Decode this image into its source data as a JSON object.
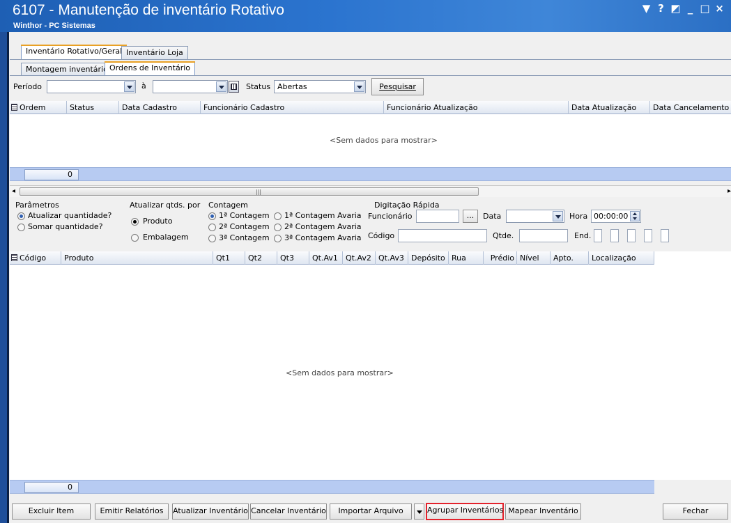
{
  "window": {
    "title": "6107 - Manutenção de inventário Rotativo",
    "subtitle": "Winthor - PC Sistemas",
    "controls": [
      "▼",
      "?",
      "◩",
      "_",
      "□",
      "×"
    ]
  },
  "tabs_top": [
    {
      "label": "Inventário Rotativo/Geral",
      "active": true
    },
    {
      "label": "Inventário Loja",
      "active": false
    }
  ],
  "tabs_sub": [
    {
      "label": "Montagem inventário",
      "active": false
    },
    {
      "label": "Ordens de Inventário",
      "active": true
    }
  ],
  "filters": {
    "periodo_label": "Período",
    "periodo_from": "",
    "a_label": "à",
    "periodo_to": "",
    "status_label": "Status",
    "status_value": "Abertas",
    "search_button": "Pesquisar"
  },
  "orders_grid": {
    "columns": [
      "Ordem",
      "Status",
      "Data Cadastro",
      "Funcionário Cadastro",
      "Funcionário Atualização",
      "Data Atualização",
      "Data Cancelamento"
    ],
    "empty_text": "<Sem dados para mostrar>",
    "count": "0"
  },
  "params": {
    "section_label": "Parâmetros",
    "options": [
      "Atualizar quantidade?",
      "Somar quantidade?"
    ],
    "selected": "Atualizar quantidade?"
  },
  "update_by": {
    "section_label": "Atualizar qtds. por",
    "options": [
      "Produto",
      "Embalagem"
    ],
    "selected": "Produto"
  },
  "contagem": {
    "section_label": "Contagem",
    "options": [
      "1ª Contagem",
      "1ª Contagem Avaria",
      "2ª Contagem",
      "2ª Contagem Avaria",
      "3ª Contagem",
      "3ª Contagem Avaria"
    ],
    "selected": "1ª Contagem"
  },
  "quick_entry": {
    "section_label": "Digitação Rápida",
    "funcionario_label": "Funcionário",
    "funcionario_value": "",
    "ellipsis": "...",
    "data_label": "Data",
    "data_value": "",
    "hora_label": "Hora",
    "hora_value": "00:00:00",
    "codigo_label": "Código",
    "codigo_value": "",
    "qtde_label": "Qtde.",
    "qtde_value": "",
    "end_label": "End."
  },
  "items_grid": {
    "columns": [
      "Código",
      "Produto",
      "Qt1",
      "Qt2",
      "Qt3",
      "Qt.Av1",
      "Qt.Av2",
      "Qt.Av3",
      "Depósito",
      "Rua",
      "Prédio",
      "Nível",
      "Apto.",
      "Localização"
    ],
    "empty_text": "<Sem dados para mostrar>",
    "count": "0"
  },
  "buttons": {
    "excluir_item": "Excluir Item",
    "emitir_relatorios": "Emitir Relatórios",
    "atualizar_inventario": "Atualizar Inventário",
    "cancelar_inventario": "Cancelar Inventário",
    "importar_arquivo": "Importar Arquivo",
    "agrupar_inventarios": "Agrupar Inventários",
    "mapear_inventario": "Mapear Inventário",
    "fechar": "Fechar"
  },
  "colors": {
    "titlebar": "#2b74cf",
    "highlight_border": "#e3222c",
    "grid_footer": "#b7cbf2"
  }
}
